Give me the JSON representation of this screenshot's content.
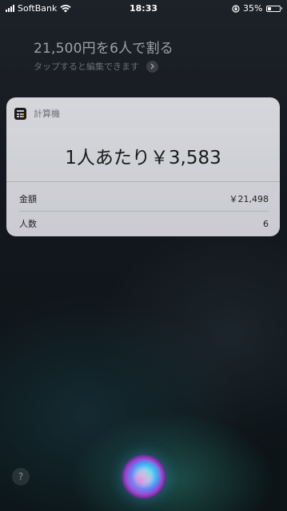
{
  "status_bar": {
    "carrier": "SoftBank",
    "time": "18:33",
    "battery_percent": "35%",
    "battery_level": 0.35,
    "icons": [
      "signal-bars-icon",
      "wifi-icon",
      "rotation-lock-icon",
      "battery-icon"
    ]
  },
  "query": {
    "text": "21,500円を6人で割る",
    "edit_hint": "タップすると編集できます",
    "chevron_icon": "chevron-right-icon"
  },
  "card": {
    "app_name": "計算機",
    "app_icon": "calculator-icon",
    "result": "1人あたり￥3,583",
    "rows": [
      {
        "label": "金額",
        "value": "￥21,498"
      },
      {
        "label": "人数",
        "value": "6"
      }
    ]
  },
  "bottom": {
    "help_label": "?",
    "siri_icon": "siri-orb-icon"
  }
}
